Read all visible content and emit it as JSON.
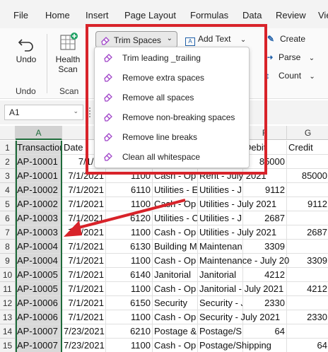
{
  "menu": {
    "tabs": [
      "File",
      "Home",
      "Insert",
      "Page Layout",
      "Formulas",
      "Data",
      "Review",
      "Vie"
    ]
  },
  "ribbon": {
    "undo_label": "Undo",
    "health_scan_label_1": "Health",
    "health_scan_label_2": "Scan",
    "group_undo": "Undo",
    "group_scan": "Scan",
    "trim_spaces_label": "Trim Spaces",
    "add_text_label": "Add Text",
    "create_label": "Create",
    "parse_label": "Parse",
    "count_label": "Count"
  },
  "dropdown": {
    "items": [
      "Trim leading _trailing",
      "Remove extra spaces",
      "Remove all spaces",
      "Remove non-breaking spaces",
      "Remove line breaks",
      "Clean all whitespace"
    ]
  },
  "formula_bar": {
    "name_box": "A1"
  },
  "grid": {
    "columns": [
      "A",
      "",
      "",
      "",
      "",
      "F",
      "G"
    ],
    "row_numbers": [
      "1",
      "2",
      "3",
      "4",
      "5",
      "6",
      "7",
      "8",
      "9",
      "10",
      "11",
      "12",
      "13",
      "14",
      "15"
    ],
    "rows": [
      [
        "Transaction",
        "Date",
        "",
        "",
        "",
        "Debit",
        "Credit"
      ],
      [
        "AP-10001",
        "7/1/20",
        "",
        "",
        "",
        "85000",
        ""
      ],
      [
        "AP-10001",
        "7/1/2021",
        "1100",
        "Cash - Op",
        "Rent - July 2021",
        "",
        "85000"
      ],
      [
        "AP-10002",
        "7/1/2021",
        "6110",
        "Utilities - E",
        "Utilities - J",
        "9112",
        ""
      ],
      [
        "AP-10002",
        "7/1/2021",
        "1100",
        "Cash - Op",
        "Utilities - July 2021",
        "",
        "9112"
      ],
      [
        "AP-10003",
        "7/1/2021",
        "6120",
        "Utilities - C",
        "Utilities - J",
        "2687",
        ""
      ],
      [
        "AP-10003",
        "7/1/2021",
        "1100",
        "Cash - Op",
        "Utilities - July 2021",
        "",
        "2687"
      ],
      [
        "AP-10004",
        "7/1/2021",
        "6130",
        "Building M",
        "Maintenan",
        "3309",
        ""
      ],
      [
        "AP-10004",
        "7/1/2021",
        "1100",
        "Cash - Op",
        "Maintenance - July 20",
        "",
        "3309"
      ],
      [
        "AP-10005",
        "7/1/2021",
        "6140",
        "Janitorial",
        "Janitorial",
        "4212",
        ""
      ],
      [
        "AP-10005",
        "7/1/2021",
        "1100",
        "Cash - Op",
        "Janitorial - July 2021",
        "",
        "4212"
      ],
      [
        "AP-10006",
        "7/1/2021",
        "6150",
        "Security",
        "Security - J",
        "2330",
        ""
      ],
      [
        "AP-10006",
        "7/1/2021",
        "1100",
        "Cash - Op",
        "Security - July 2021",
        "",
        "2330"
      ],
      [
        "AP-10007",
        "7/23/2021",
        "6210",
        "Postage &",
        "Postage/S",
        "64",
        ""
      ],
      [
        "AP-10007",
        "7/23/2021",
        "1100",
        "Cash - Op",
        "Postage/Shipping",
        "",
        "64"
      ]
    ]
  },
  "colors": {
    "highlight_red": "#d8232a",
    "selection_green": "#1e6b3a",
    "eraser_purple": "#a044c8"
  }
}
